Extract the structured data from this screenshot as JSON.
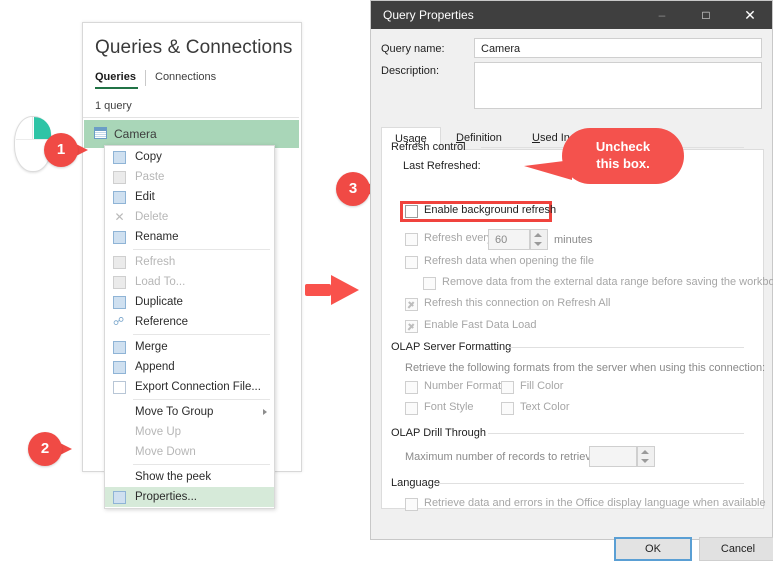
{
  "queries_pane": {
    "title": "Queries & Connections",
    "tabs": [
      {
        "label": "Queries",
        "selected": true
      },
      {
        "label": "Connections",
        "selected": false
      }
    ],
    "count_text": "1 query",
    "selected_query": "Camera",
    "query_icon": "table-icon"
  },
  "context_menu": {
    "items": [
      {
        "label": "Copy",
        "enabled": true,
        "icon": "copy-icon"
      },
      {
        "label": "Paste",
        "enabled": false,
        "icon": "paste-icon"
      },
      {
        "label": "Edit",
        "enabled": true,
        "icon": "edit-icon"
      },
      {
        "label": "Delete",
        "enabled": false,
        "icon": "delete-x-icon"
      },
      {
        "label": "Rename",
        "enabled": true,
        "icon": "rename-icon"
      },
      {
        "label": "Refresh",
        "enabled": false,
        "icon": "refresh-icon"
      },
      {
        "label": "Load To...",
        "enabled": false,
        "icon": "load-to-icon"
      },
      {
        "label": "Duplicate",
        "enabled": true,
        "icon": "duplicate-icon"
      },
      {
        "label": "Reference",
        "enabled": true,
        "icon": "reference-icon"
      },
      {
        "label": "Merge",
        "enabled": true,
        "icon": "merge-icon"
      },
      {
        "label": "Append",
        "enabled": true,
        "icon": "append-icon"
      },
      {
        "label": "Export Connection File...",
        "enabled": true,
        "icon": "export-file-icon"
      },
      {
        "label": "Move To Group",
        "enabled": true,
        "icon": "none",
        "submenu": true
      },
      {
        "label": "Move Up",
        "enabled": false,
        "icon": "none"
      },
      {
        "label": "Move Down",
        "enabled": false,
        "icon": "none"
      },
      {
        "label": "Show the peek",
        "enabled": true,
        "icon": "none"
      },
      {
        "label": "Properties...",
        "enabled": true,
        "icon": "properties-icon",
        "highlighted": true
      }
    ]
  },
  "annotations": {
    "accent_color": "#f04a45",
    "steps": [
      {
        "number": "1",
        "target": "camera-query-row"
      },
      {
        "number": "2",
        "target": "properties-menu-item"
      },
      {
        "number": "3",
        "target": "enable-background-refresh-checkbox"
      }
    ],
    "callout": {
      "line1": "Uncheck",
      "line2": "this box."
    },
    "mouse_icon": "mouse-right-click-icon",
    "flow_arrow": "red-right-arrow"
  },
  "dialog": {
    "title": "Query Properties",
    "window_buttons": {
      "minimize": "–",
      "maximize": "□",
      "close": "✕"
    },
    "fields": {
      "query_name_label": "Query name:",
      "query_name_value": "Camera",
      "description_label": "Description:",
      "description_value": ""
    },
    "tabs": [
      {
        "label": "Usage",
        "accesskey": "g",
        "selected": true
      },
      {
        "label": "Definition",
        "accesskey": "D",
        "selected": false
      },
      {
        "label": "Used In",
        "accesskey": "U",
        "selected": false
      }
    ],
    "refresh_control": {
      "group_label": "Refresh control",
      "last_refreshed_label": "Last Refreshed:",
      "last_refreshed_value": "",
      "enable_background_refresh": {
        "label": "Enable background refresh",
        "checked": false,
        "enabled": true
      },
      "refresh_every": {
        "label": "Refresh every",
        "checked": false,
        "enabled": false,
        "value": "60",
        "unit": "minutes"
      },
      "refresh_on_open": {
        "label": "Refresh data when opening the file",
        "checked": false,
        "enabled": false
      },
      "remove_data": {
        "label": "Remove data from the external data range before saving the workbook",
        "checked": false,
        "enabled": false
      },
      "refresh_all": {
        "label": "Refresh this connection on Refresh All",
        "checked": true,
        "enabled": false
      },
      "fast_data_load": {
        "label": "Enable Fast Data Load",
        "checked": true,
        "enabled": false
      }
    },
    "olap_formatting": {
      "group_label": "OLAP Server Formatting",
      "description": "Retrieve the following formats from the server when using this connection:",
      "options": [
        {
          "label": "Number Format",
          "checked": false,
          "enabled": false
        },
        {
          "label": "Fill Color",
          "checked": false,
          "enabled": false
        },
        {
          "label": "Font Style",
          "checked": false,
          "enabled": false
        },
        {
          "label": "Text Color",
          "checked": false,
          "enabled": false
        }
      ]
    },
    "olap_drill": {
      "group_label": "OLAP Drill Through",
      "max_records_label": "Maximum number of records to retrieve:",
      "max_records_value": ""
    },
    "language": {
      "group_label": "Language",
      "option": {
        "label": "Retrieve data and errors in the Office display language when available",
        "checked": false,
        "enabled": false
      }
    },
    "buttons": {
      "ok": "OK",
      "cancel": "Cancel"
    }
  }
}
